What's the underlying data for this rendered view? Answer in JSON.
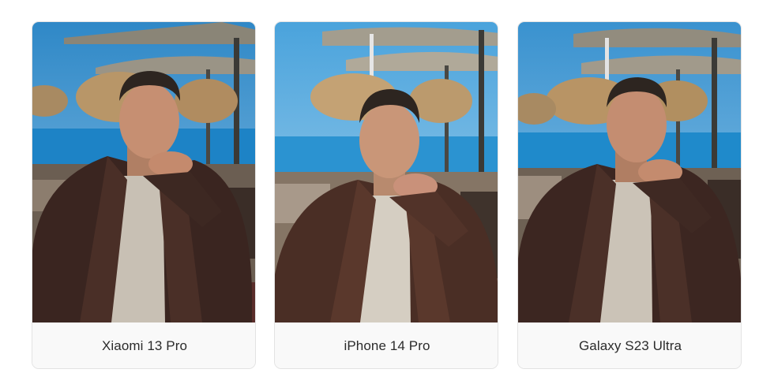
{
  "gallery": {
    "cards": [
      {
        "label": "Xiaomi 13 Pro"
      },
      {
        "label": "iPhone 14 Pro"
      },
      {
        "label": "Galaxy S23 Ultra"
      }
    ]
  },
  "colors": {
    "card_border": "#e3e3e3",
    "card_background": "#f9f9f9",
    "caption_text": "#2b2b2b",
    "sky": "#3f9bd4",
    "sea": "#1f86c9",
    "jacket": "#3b2620",
    "shirt": "#c9c1b5",
    "skin": "#c58f72"
  }
}
